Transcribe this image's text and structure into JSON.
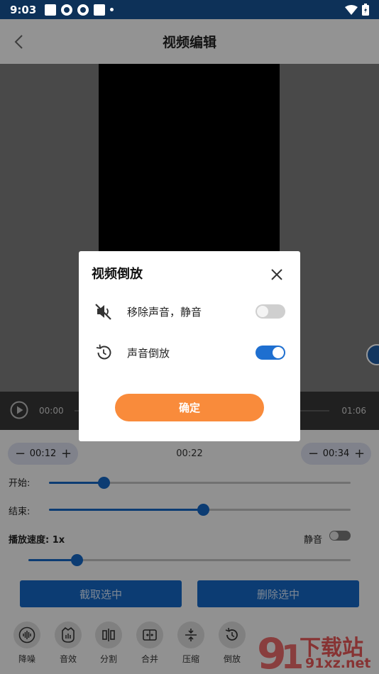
{
  "status_bar": {
    "time": "9:03"
  },
  "app_bar": {
    "title": "视频编辑"
  },
  "player": {
    "current_time": "00:00",
    "total_time": "01:06"
  },
  "trim": {
    "start_stepper_value": "00:12",
    "end_stepper_value": "00:34",
    "selected_duration": "00:22",
    "start_label": "开始:",
    "end_label": "结束:",
    "start_fraction": 0.18,
    "end_fraction": 0.51
  },
  "speed": {
    "label": "播放速度: 1x",
    "fraction": 0.15
  },
  "mute": {
    "label": "静音"
  },
  "actions": {
    "cut_selected": "截取选中",
    "delete_selected": "删除选中"
  },
  "tools": [
    {
      "label": "降噪",
      "icon": "waveform-icon"
    },
    {
      "label": "音效",
      "icon": "sound-effect-icon"
    },
    {
      "label": "分割",
      "icon": "split-icon"
    },
    {
      "label": "合并",
      "icon": "merge-icon"
    },
    {
      "label": "压缩",
      "icon": "compress-icon"
    },
    {
      "label": "倒放",
      "icon": "reverse-icon"
    }
  ],
  "dialog": {
    "title": "视频倒放",
    "option_mute": {
      "label": "移除声音，静音",
      "enabled": false
    },
    "option_reverse_audio": {
      "label": "声音倒放",
      "enabled": true
    },
    "confirm_label": "确定"
  },
  "watermark": {
    "text": "下载站",
    "domain": "91xz.net"
  }
}
